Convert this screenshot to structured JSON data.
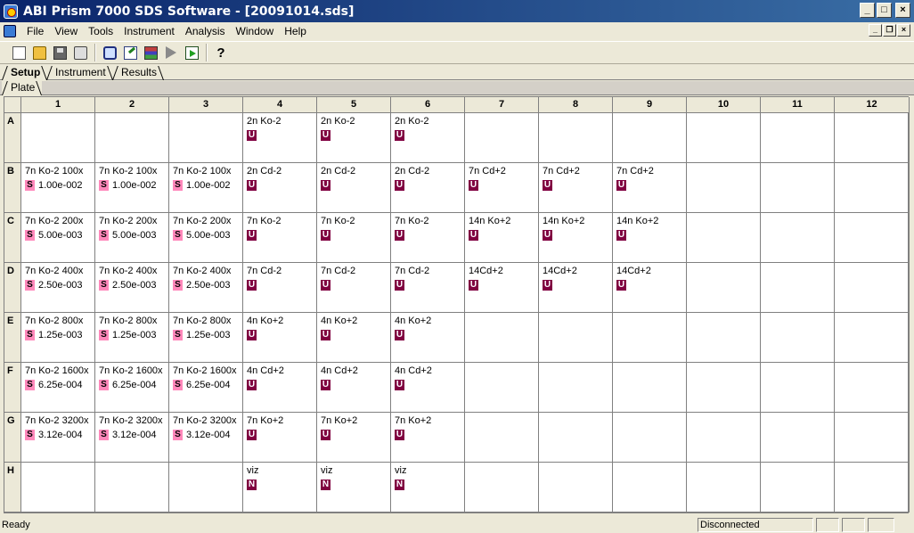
{
  "window": {
    "title": "ABI Prism 7000 SDS Software - [20091014.sds]",
    "controls": {
      "minimize": "_",
      "maximize": "□",
      "close": "×"
    }
  },
  "menu": {
    "items": [
      "File",
      "View",
      "Tools",
      "Instrument",
      "Analysis",
      "Window",
      "Help"
    ],
    "mdi_controls": {
      "minimize": "_",
      "restore": "❐",
      "close": "×"
    }
  },
  "toolbar": {
    "buttons": [
      {
        "name": "new-file-icon"
      },
      {
        "name": "open-folder-icon"
      },
      {
        "name": "save-icon"
      },
      {
        "name": "print-icon"
      },
      {
        "name": "zoom-icon"
      },
      {
        "name": "edit-icon"
      },
      {
        "name": "grid-icon"
      },
      {
        "name": "play-icon"
      },
      {
        "name": "run-icon"
      },
      {
        "name": "help-icon",
        "label": "?"
      }
    ]
  },
  "tabs": {
    "primary": [
      "Setup",
      "Instrument",
      "Results"
    ],
    "active": "Setup",
    "secondary": [
      "Plate"
    ]
  },
  "plate": {
    "columns": [
      "1",
      "2",
      "3",
      "4",
      "5",
      "6",
      "7",
      "8",
      "9",
      "10",
      "11",
      "12"
    ],
    "rows": [
      {
        "label": "A",
        "cells": [
          null,
          null,
          null,
          {
            "name": "2n Ko-2",
            "task": "U"
          },
          {
            "name": "2n Ko-2",
            "task": "U"
          },
          {
            "name": "2n Ko-2",
            "task": "U"
          },
          null,
          null,
          null,
          null,
          null,
          null
        ]
      },
      {
        "label": "B",
        "cells": [
          {
            "name": "7n Ko-2 100x",
            "task": "S",
            "qty": "1.00e-002"
          },
          {
            "name": "7n Ko-2 100x",
            "task": "S",
            "qty": "1.00e-002"
          },
          {
            "name": "7n Ko-2 100x",
            "task": "S",
            "qty": "1.00e-002"
          },
          {
            "name": "2n Cd-2",
            "task": "U"
          },
          {
            "name": "2n Cd-2",
            "task": "U"
          },
          {
            "name": "2n Cd-2",
            "task": "U"
          },
          {
            "name": "7n Cd+2",
            "task": "U"
          },
          {
            "name": "7n Cd+2",
            "task": "U"
          },
          {
            "name": "7n Cd+2",
            "task": "U"
          },
          null,
          null,
          null
        ]
      },
      {
        "label": "C",
        "cells": [
          {
            "name": "7n Ko-2 200x",
            "task": "S",
            "qty": "5.00e-003"
          },
          {
            "name": "7n Ko-2 200x",
            "task": "S",
            "qty": "5.00e-003"
          },
          {
            "name": "7n Ko-2 200x",
            "task": "S",
            "qty": "5.00e-003"
          },
          {
            "name": "7n Ko-2",
            "task": "U"
          },
          {
            "name": "7n Ko-2",
            "task": "U"
          },
          {
            "name": "7n Ko-2",
            "task": "U"
          },
          {
            "name": "14n Ko+2",
            "task": "U"
          },
          {
            "name": "14n Ko+2",
            "task": "U"
          },
          {
            "name": "14n Ko+2",
            "task": "U"
          },
          null,
          null,
          null
        ]
      },
      {
        "label": "D",
        "cells": [
          {
            "name": "7n Ko-2 400x",
            "task": "S",
            "qty": "2.50e-003"
          },
          {
            "name": "7n Ko-2 400x",
            "task": "S",
            "qty": "2.50e-003"
          },
          {
            "name": "7n Ko-2 400x",
            "task": "S",
            "qty": "2.50e-003"
          },
          {
            "name": "7n Cd-2",
            "task": "U"
          },
          {
            "name": "7n Cd-2",
            "task": "U"
          },
          {
            "name": "7n Cd-2",
            "task": "U"
          },
          {
            "name": "14Cd+2",
            "task": "U"
          },
          {
            "name": "14Cd+2",
            "task": "U"
          },
          {
            "name": "14Cd+2",
            "task": "U"
          },
          null,
          null,
          null
        ]
      },
      {
        "label": "E",
        "cells": [
          {
            "name": "7n Ko-2 800x",
            "task": "S",
            "qty": "1.25e-003"
          },
          {
            "name": "7n Ko-2 800x",
            "task": "S",
            "qty": "1.25e-003"
          },
          {
            "name": "7n Ko-2 800x",
            "task": "S",
            "qty": "1.25e-003"
          },
          {
            "name": "4n Ko+2",
            "task": "U"
          },
          {
            "name": "4n Ko+2",
            "task": "U"
          },
          {
            "name": "4n Ko+2",
            "task": "U"
          },
          null,
          null,
          null,
          null,
          null,
          null
        ]
      },
      {
        "label": "F",
        "cells": [
          {
            "name": "7n Ko-2 1600x",
            "task": "S",
            "qty": "6.25e-004"
          },
          {
            "name": "7n Ko-2 1600x",
            "task": "S",
            "qty": "6.25e-004"
          },
          {
            "name": "7n Ko-2 1600x",
            "task": "S",
            "qty": "6.25e-004"
          },
          {
            "name": "4n Cd+2",
            "task": "U"
          },
          {
            "name": "4n Cd+2",
            "task": "U"
          },
          {
            "name": "4n Cd+2",
            "task": "U"
          },
          null,
          null,
          null,
          null,
          null,
          null
        ]
      },
      {
        "label": "G",
        "cells": [
          {
            "name": "7n Ko-2 3200x",
            "task": "S",
            "qty": "3.12e-004"
          },
          {
            "name": "7n Ko-2 3200x",
            "task": "S",
            "qty": "3.12e-004"
          },
          {
            "name": "7n Ko-2 3200x",
            "task": "S",
            "qty": "3.12e-004"
          },
          {
            "name": "7n Ko+2",
            "task": "U"
          },
          {
            "name": "7n Ko+2",
            "task": "U"
          },
          {
            "name": "7n Ko+2",
            "task": "U"
          },
          null,
          null,
          null,
          null,
          null,
          null
        ]
      },
      {
        "label": "H",
        "cells": [
          null,
          null,
          null,
          {
            "name": "viz",
            "task": "N"
          },
          {
            "name": "viz",
            "task": "N"
          },
          {
            "name": "viz",
            "task": "N"
          },
          null,
          null,
          null,
          null,
          null,
          null
        ]
      }
    ]
  },
  "status": {
    "text": "Ready",
    "connection": "Disconnected"
  }
}
